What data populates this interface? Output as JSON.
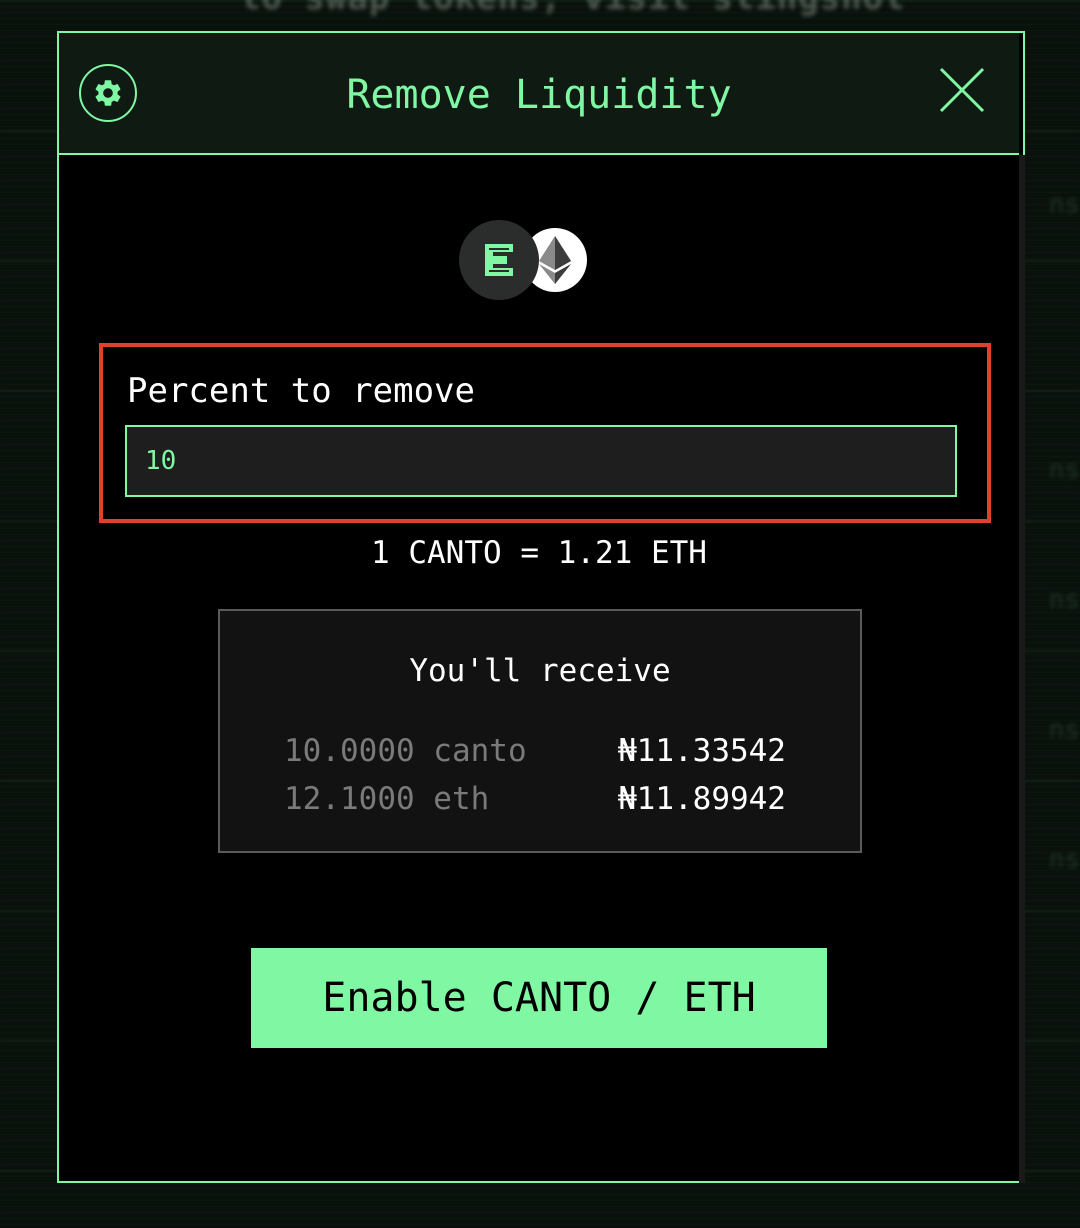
{
  "background": {
    "top_text": "to swap tokens, visit slingshot",
    "side_texts": [
      "ns",
      "ns",
      "ns",
      "ns",
      "ns",
      "ns"
    ]
  },
  "modal": {
    "title": "Remove Liquidity",
    "settings_icon": "gear-icon",
    "close_icon": "close-icon",
    "tokens": [
      {
        "symbol": "CANTO",
        "icon": "canto-logo-icon"
      },
      {
        "symbol": "ETH",
        "icon": "eth-logo-icon"
      }
    ],
    "percent": {
      "label": "Percent to remove",
      "value": "10"
    },
    "rate": "1 CANTO = 1.21 ETH",
    "receive": {
      "title": "You'll receive",
      "rows": [
        {
          "amount": "10.0000 canto",
          "value": "₦11.33542"
        },
        {
          "amount": "12.1000 eth",
          "value": "₦11.89942"
        }
      ]
    },
    "enable_button": "Enable CANTO / ETH"
  },
  "colors": {
    "accent": "#7ff7a3",
    "highlight_border": "#e0402c",
    "background": "#000000"
  }
}
